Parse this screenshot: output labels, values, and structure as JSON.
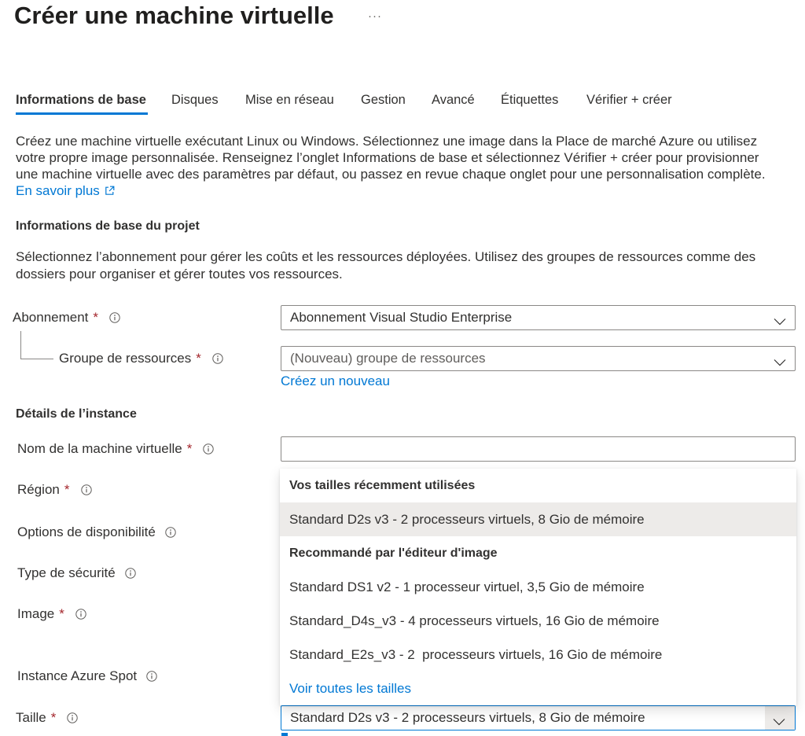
{
  "header": {
    "title": "Créer une machine virtuelle",
    "more_glyph": "···",
    "more_icon": "more-icon"
  },
  "tabs": [
    {
      "label": "Informations de base",
      "active": true
    },
    {
      "label": "Disques"
    },
    {
      "label": "Mise en réseau"
    },
    {
      "label": "Gestion"
    },
    {
      "label": "Avancé"
    },
    {
      "label": "Étiquettes"
    },
    {
      "label": "Vérifier + créer"
    }
  ],
  "intro": {
    "lines": [
      "Créez une machine virtuelle exécutant Linux ou Windows. Sélectionnez une image dans la Place de marché Azure ou utilisez",
      "votre propre image personnalisée. Renseignez l’onglet Informations de base et sélectionnez Vérifier + créer pour provisionner",
      "une machine virtuelle avec des paramètres par défaut, ou passez en revue chaque onglet pour une personnalisation complète."
    ],
    "learn_more": "En savoir plus",
    "learn_more_icon": "external-link-icon"
  },
  "project": {
    "heading": "Informations de base du projet",
    "description_lines": [
      "Sélectionnez l’abonnement pour gérer les coûts et les ressources déployées. Utilisez des groupes de ressources comme des",
      "dossiers pour organiser et gérer toutes vos ressources."
    ]
  },
  "form": {
    "subscription": {
      "label": "Abonnement",
      "required": "*",
      "value": "Abonnement Visual Studio Enterprise"
    },
    "resource_group": {
      "label": "Groupe de ressources",
      "required": "*",
      "value": "(Nouveau) groupe de ressources",
      "create_new": "Créez un nouveau"
    },
    "instance_heading": "Détails de l’instance",
    "vm_name": {
      "label": "Nom de la machine virtuelle",
      "required": "*",
      "value": ""
    },
    "region": {
      "label": "Région",
      "required": "*"
    },
    "availability": {
      "label": "Options de disponibilité"
    },
    "security_type": {
      "label": "Type de sécurité"
    },
    "image": {
      "label": "Image",
      "required": "*"
    },
    "spot": {
      "label": "Instance Azure Spot"
    },
    "size": {
      "label": "Taille",
      "required": "*",
      "value": "Standard D2s v3 - 2 processeurs virtuels, 8 Gio de mémoire"
    }
  },
  "size_menu": {
    "groups": [
      {
        "heading": "Vos tailles récemment utilisées",
        "options": [
          {
            "label": "Standard D2s v3 - 2 processeurs virtuels, 8 Gio de mémoire",
            "selected": true
          }
        ]
      },
      {
        "heading": "Recommandé par l'éditeur d'image",
        "options": [
          {
            "label": "Standard DS1 v2 - 1 processeur virtuel, 3,5 Gio de mémoire"
          },
          {
            "label": "Standard_D4s_v3 - 4 processeurs virtuels, 16 Gio de mémoire"
          },
          {
            "label": "Standard_E2s_v3 - 2  processeurs virtuels, 16 Gio de mémoire"
          }
        ]
      }
    ],
    "see_all": "Voir toutes les tailles"
  },
  "icons": {
    "info": "info-icon",
    "chevron": "chevron-down-icon",
    "external_link": "external-link-icon"
  },
  "colors": {
    "accent": "#0078d4",
    "required": "#a4262c",
    "text": "#323130",
    "selected_option": "#edebe9",
    "border": "#8a8886"
  }
}
